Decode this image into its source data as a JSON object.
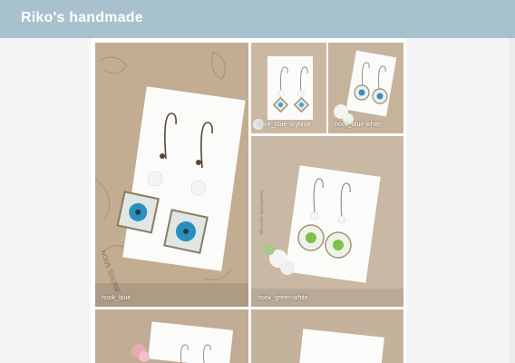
{
  "header": {
    "title": "Riko's handmade"
  },
  "gallery": {
    "items": [
      {
        "caption": "hook_blue",
        "theme": "blue-square"
      },
      {
        "caption": "hook_blue-skyblue",
        "theme": "blue-skyblue-square"
      },
      {
        "caption": "hook_blue-white",
        "theme": "blue-white-round"
      },
      {
        "caption": "hook_green-white",
        "theme": "green-white-round"
      },
      {
        "caption": "",
        "theme": "pink-flower"
      },
      {
        "caption": "",
        "theme": "card"
      }
    ]
  },
  "colors": {
    "header_bg": "#a7c2cc",
    "tile_bg": "#c4b29a",
    "card": "#fbfbfa"
  }
}
